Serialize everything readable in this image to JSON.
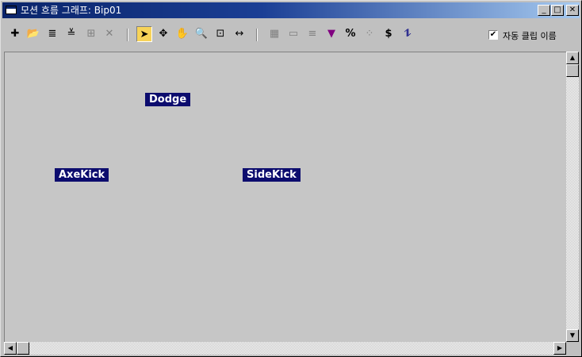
{
  "window": {
    "title": "모션 흐름 그래프: Bip01",
    "controls": {
      "minimize": "_",
      "maximize": "□",
      "close": "✕"
    }
  },
  "toolbar": {
    "tools": [
      {
        "name": "create-clip-icon",
        "glyph": "✚",
        "enabled": true
      },
      {
        "name": "open-clip-icon",
        "glyph": "📂",
        "enabled": true
      },
      {
        "name": "show-graph-icon",
        "glyph": "≣",
        "enabled": true
      },
      {
        "name": "create-transition-icon",
        "glyph": "≚",
        "enabled": true
      },
      {
        "name": "optimize-transitions-icon",
        "glyph": "⊞",
        "enabled": false
      },
      {
        "name": "delete-icon",
        "glyph": "✕",
        "enabled": false
      },
      {
        "name": "select-icon",
        "glyph": "➤",
        "enabled": true,
        "active": true
      },
      {
        "name": "move-icon",
        "glyph": "✥",
        "enabled": true
      },
      {
        "name": "pan-icon",
        "glyph": "✋",
        "enabled": true
      },
      {
        "name": "zoom-icon",
        "glyph": "🔍",
        "enabled": true
      },
      {
        "name": "zoom-region-icon",
        "glyph": "⊡",
        "enabled": true
      },
      {
        "name": "zoom-extents-icon",
        "glyph": "↔",
        "enabled": true
      },
      {
        "name": "script-icon",
        "glyph": "▦",
        "enabled": false
      },
      {
        "name": "clip-icon",
        "glyph": "▭",
        "enabled": false
      },
      {
        "name": "properties-icon",
        "glyph": "≡",
        "enabled": false
      },
      {
        "name": "select-random-start-icon",
        "glyph": "▼",
        "enabled": true
      },
      {
        "name": "percent-icon",
        "glyph": "%",
        "enabled": true
      },
      {
        "name": "random-transition-icon",
        "glyph": "⁘",
        "enabled": false
      },
      {
        "name": "cost-icon",
        "glyph": "$",
        "enabled": true
      },
      {
        "name": "random-motion-icon",
        "glyph": "⥮",
        "enabled": true
      }
    ],
    "auto_clip_names": {
      "checked": true,
      "label": "자동 클립 이름"
    }
  },
  "graph": {
    "nodes": [
      {
        "label": "Dodge"
      },
      {
        "label": "AxeKick"
      },
      {
        "label": "SideKick"
      }
    ]
  },
  "scroll": {
    "up": "▲",
    "down": "▼",
    "left": "◀",
    "right": "▶"
  },
  "colors": {
    "title_bar": "#0a246a",
    "node_bg": "#0c0c6e",
    "active_tool": "#f7d358",
    "canvas_bg": "#c6c6c6"
  }
}
